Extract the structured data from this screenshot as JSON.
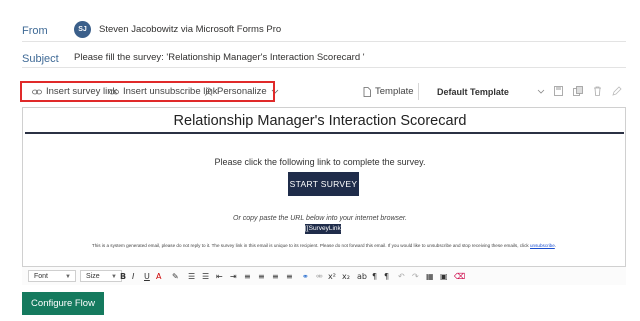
{
  "from": {
    "label": "From",
    "avatar_initials": "SJ",
    "sender": "Steven Jacobowitz via Microsoft Forms Pro"
  },
  "subject": {
    "label": "Subject",
    "value": "Please fill the survey: 'Relationship Manager's Interaction Scorecard '"
  },
  "toolbar": {
    "insert_survey_link": "Insert survey link",
    "insert_unsubscribe_link": "Insert unsubscribe link",
    "personalize": "Personalize",
    "template_label": "Template",
    "template_selected": "Default Template"
  },
  "email": {
    "title": "Relationship Manager's Interaction Scorecard",
    "instruction": "Please click the following link to complete the survey.",
    "start_button": "START SURVEY",
    "copy_text": "Or copy paste the URL below into your internet browser.",
    "survey_link": "[[SurveyLink]]",
    "disclaimer": "This is a system generated email, please do not reply to it. The survey link in this email is unique to its recipient. Please do not forward this email. If you would like to unsubscribe and stop receiving these emails, click",
    "unsubscribe": "unsubscribe"
  },
  "format_bar": {
    "font": "Font",
    "size": "Size",
    "bold": "B",
    "italic": "I",
    "underline": "U",
    "font_color": "A",
    "superscript": "x²",
    "subscript": "x₂"
  },
  "configure_flow_button": "Configure Flow",
  "colors": {
    "label_blue": "#3f6a96",
    "highlight_red": "#e02a2a",
    "navy": "#1f2c4a",
    "green_button": "#157a5e"
  }
}
